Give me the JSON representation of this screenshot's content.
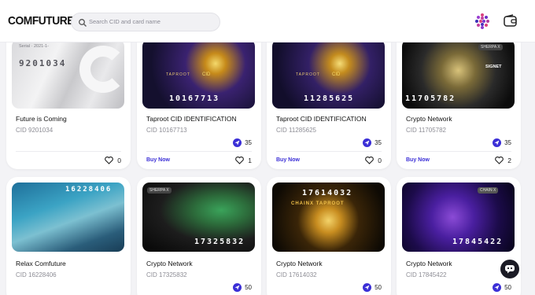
{
  "header": {
    "logo": "COMFUTURE",
    "search_placeholder": "Search CID and card name"
  },
  "cards": [
    {
      "title": "Future is Coming",
      "cid": "CID 9201034",
      "image_number": "9201034",
      "image_caption": "Serial · 2021-1-",
      "badge": "",
      "buy": "",
      "likes": "0"
    },
    {
      "title": "Taproot CID IDENTIFICATION",
      "cid": "CID 10167713",
      "image_number": "10167713",
      "image_caption": "TAPROOT",
      "image_sub": "CID",
      "badge": "35",
      "buy": "Buy Now",
      "likes": "1"
    },
    {
      "title": "Taproot CID IDENTIFICATION",
      "cid": "CID 11285625",
      "image_number": "11285625",
      "image_caption": "TAPROOT",
      "image_sub": "CID",
      "badge": "35",
      "buy": "Buy Now",
      "likes": "0"
    },
    {
      "title": "Crypto Network",
      "cid": "CID 11705782",
      "image_number": "11705782",
      "image_caption": "SHERPA X",
      "image_sub": "SIGNET",
      "badge": "35",
      "buy": "Buy Now",
      "likes": "2"
    },
    {
      "title": "Relax Comfuture",
      "cid": "CID 16228406",
      "image_number": "16228406",
      "badge": "",
      "buy": "",
      "likes": ""
    },
    {
      "title": "Crypto Network",
      "cid": "CID 17325832",
      "image_number": "17325832",
      "image_caption": "SHERPA X",
      "badge": "50",
      "buy": "",
      "likes": ""
    },
    {
      "title": "Crypto Network",
      "cid": "CID 17614032",
      "image_number": "17614032",
      "image_caption": "CHAINX TAPROOT",
      "badge": "50",
      "buy": "",
      "likes": ""
    },
    {
      "title": "Crypto Network",
      "cid": "CID 17845422",
      "image_number": "17845422",
      "image_caption": "CHAIN X",
      "badge": "50",
      "buy": "",
      "likes": ""
    }
  ],
  "colors": {
    "accent": "#3b2fd6",
    "background": "#f3f3f6"
  },
  "icons": {
    "search": "search-icon",
    "avatar": "hexagon-avatar-icon",
    "wallet": "wallet-icon",
    "badge": "send-arrow-icon",
    "like": "heart-icon",
    "chat": "chatbot-icon"
  }
}
